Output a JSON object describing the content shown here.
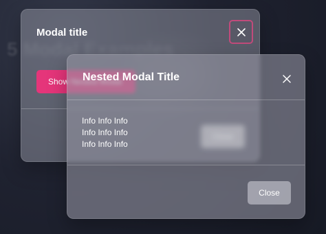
{
  "background": {
    "title": "5 Modal Examples"
  },
  "modal1": {
    "title": "Modal title",
    "close_icon": "close-icon",
    "show_button_label": "Show Nested Modal"
  },
  "modal2": {
    "title": "Nested Modal Title",
    "close_icon": "close-icon",
    "info_lines": [
      "Info Info Info",
      "Info Info Info",
      "Info Info Info"
    ],
    "blurred_button_label": "Close",
    "close_button_label": "Close"
  },
  "colors": {
    "accent": "#e5357a",
    "focus_ring": "#c14b7b",
    "modal_fill": "rgba(150,150,164,0.58)"
  }
}
